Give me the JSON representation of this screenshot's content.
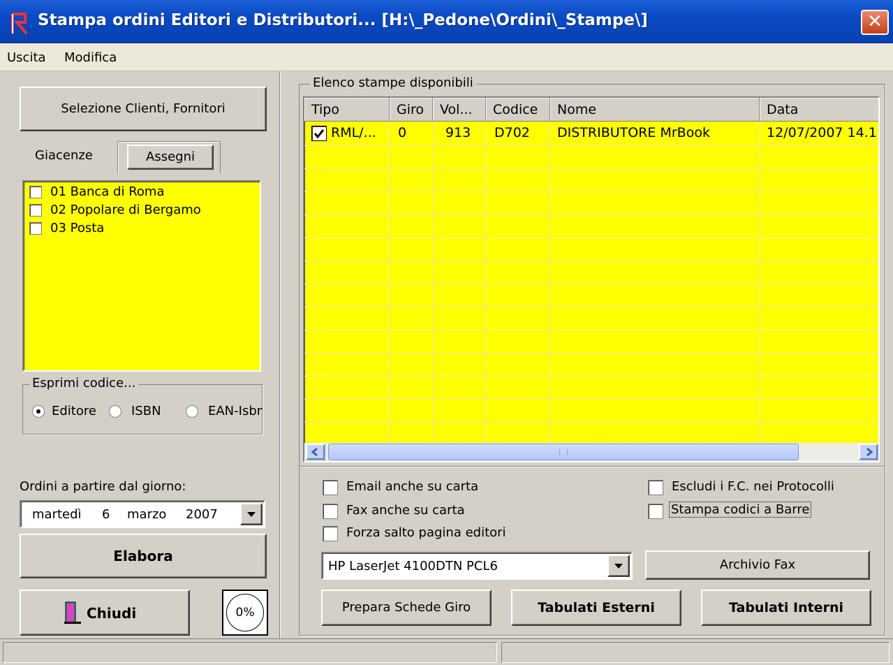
{
  "window": {
    "title": "Stampa ordini Editori e Distributori... [H:\\_Pedone\\Ordini\\_Stampe\\]",
    "close_label": "✕"
  },
  "menu": [
    "Uscita",
    "Modifica"
  ],
  "left": {
    "select_button": "Selezione Clienti, Fornitori",
    "tabs": [
      {
        "label": "Giacenze",
        "active": false
      },
      {
        "label": "Assegni",
        "active": true
      }
    ],
    "bank_list": [
      {
        "label": "01 Banca di Roma",
        "checked": false
      },
      {
        "label": "02 Popolare di Bergamo",
        "checked": false
      },
      {
        "label": "03 Posta",
        "checked": false
      }
    ],
    "code_group": {
      "legend": "Esprimi codice...",
      "options": [
        {
          "label": "Editore",
          "selected": true
        },
        {
          "label": "ISBN",
          "selected": false
        },
        {
          "label": "EAN-Isbn",
          "selected": false
        }
      ]
    },
    "date_label": "Ordini a partire dal giorno:",
    "date": {
      "weekday": "martedì",
      "day": "6",
      "month": "marzo",
      "year": "2007"
    },
    "elabora_button": "Elabora",
    "chiudi_button": "Chiudi",
    "progress_text": "0%"
  },
  "right": {
    "group_legend": "Elenco stampe disponibili",
    "columns": [
      "Tipo",
      "Giro",
      "Vol...",
      "Codice",
      "Nome",
      "Data"
    ],
    "rows": [
      {
        "checked": true,
        "tipo": "RML/...",
        "giro": "0",
        "vol": "913",
        "codice": "D702",
        "nome": "DISTRIBUTORE MrBook",
        "data": "12/07/2007 14.1"
      }
    ],
    "options_left": [
      {
        "label": "Email anche su carta",
        "checked": false
      },
      {
        "label": "Fax anche su carta",
        "checked": false
      },
      {
        "label": "Forza salto pagina editori",
        "checked": false
      }
    ],
    "options_right": [
      {
        "label": "Escludi i F.C. nei Protocolli",
        "checked": false
      },
      {
        "label": "Stampa codici a Barre",
        "checked": false
      }
    ],
    "printer": "HP LaserJet 4100DTN PCL6",
    "archivio_fax_button": "Archivio Fax",
    "prepara_button": "Prepara Schede Giro",
    "tab_esterni_button": "Tabulati Esterni",
    "tab_interni_button": "Tabulati Interni"
  },
  "colors": {
    "list_bg": "#ffff00",
    "titlebar": "#0a4ac4",
    "window_bg": "#d4d0c8"
  }
}
